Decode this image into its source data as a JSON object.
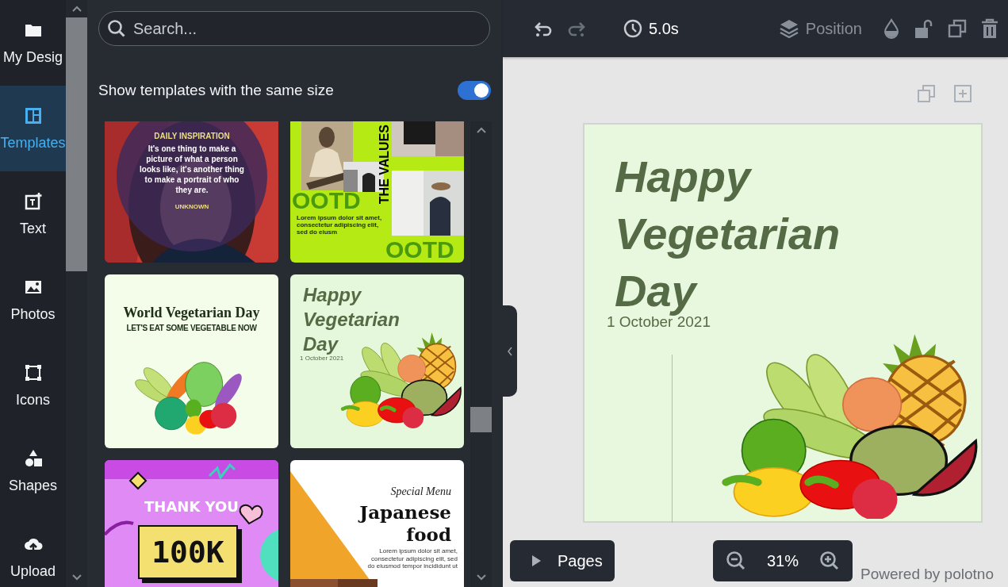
{
  "sidebar": {
    "items": [
      {
        "kind": "folder",
        "label": "My Desig",
        "selected": false
      },
      {
        "kind": "templates",
        "label": "Templates",
        "selected": true
      },
      {
        "kind": "text",
        "label": "Text",
        "selected": false
      },
      {
        "kind": "photos",
        "label": "Photos",
        "selected": false
      },
      {
        "kind": "icons",
        "label": "Icons",
        "selected": false
      },
      {
        "kind": "shapes",
        "label": "Shapes",
        "selected": false
      },
      {
        "kind": "upload",
        "label": "Upload",
        "selected": false
      }
    ]
  },
  "panel": {
    "search": {
      "placeholder": "Search..."
    },
    "same_size_toggle": {
      "label": "Show templates with the same size",
      "on": true
    },
    "templates": [
      {
        "kind": "quote",
        "heading": "DAILY INSPIRATION",
        "quote": "It's one thing to make a picture of what a person looks like, it's another thing to make a portrait of who they are.",
        "author": "UNKNOWN"
      },
      {
        "kind": "ootd",
        "vertical": "THE VALUES",
        "headline": "OOTD",
        "body": "Lorem ipsum dolor sit amet, consectetur adipiscing elit, sed do eiusm",
        "footer": "OOTD"
      },
      {
        "kind": "world-veg",
        "title": "World Vegetarian Day",
        "subtitle": "LET'S EAT SOME VEGETABLE NOW"
      },
      {
        "kind": "happy-veg",
        "title": "Happy Vegetarian Day",
        "date": "1 October 2021"
      },
      {
        "kind": "thanks",
        "title": "THANK YOU",
        "number": "100K"
      },
      {
        "kind": "menu",
        "eyebrow": "Special Menu",
        "title": "Japanese food",
        "body": "Lorem ipsum dolor sit amet, consectetur adipiscing elit, sed do eiusmod tempor incididunt ut"
      }
    ]
  },
  "toolbar": {
    "history": [
      {
        "kind": "undo",
        "disabled": false
      },
      {
        "kind": "redo",
        "disabled": true
      }
    ],
    "duration": "5.0s",
    "position_label": "Position"
  },
  "design": {
    "title": "Happy Vegetarian Day",
    "date": "1 October 2021"
  },
  "pages_button": "Pages",
  "zoom": "31%",
  "credit": "Powered by polotno"
}
